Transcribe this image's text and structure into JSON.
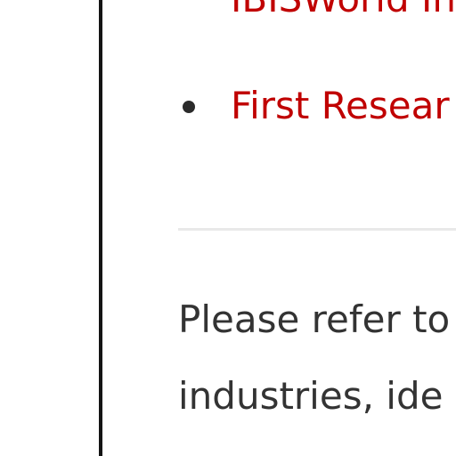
{
  "links": [
    {
      "label": "IBISWorld In"
    },
    {
      "label": "First Resear"
    }
  ],
  "body_lines": [
    "Please refer to",
    "industries, ide"
  ],
  "colors": {
    "link": "#c00000",
    "text": "#333333",
    "divider": "#e9e9e9",
    "border": "#141414"
  }
}
